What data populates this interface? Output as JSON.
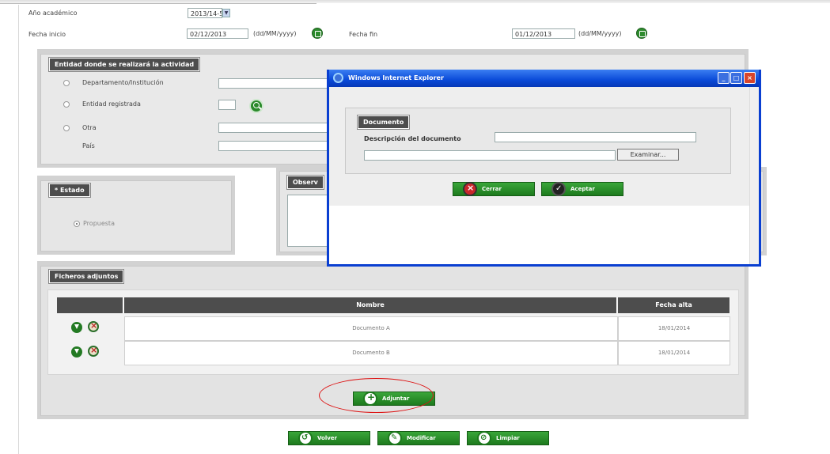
{
  "header": {
    "anio_label": "Año académico",
    "anio_value": "2013/14-5",
    "fecha_inicio_label": "Fecha inicio",
    "fecha_inicio_value": "02/12/2013",
    "fecha_inicio_format": "(dd/MM/yyyy)",
    "fecha_fin_label": "Fecha fin",
    "fecha_fin_value": "01/12/2013",
    "fecha_fin_format": "(dd/MM/yyyy)"
  },
  "entidad": {
    "legend": "Entidad donde se realizará la actividad",
    "opt_departamento": "Departamento/Institución",
    "opt_entidad": "Entidad registrada",
    "opt_otra": "Otra",
    "pais_label": "País"
  },
  "estado": {
    "legend": "* Estado",
    "option": "Propuesta"
  },
  "observaciones": {
    "legend": "Observ"
  },
  "ficheros": {
    "legend": "Ficheros adjuntos",
    "col_nombre": "Nombre",
    "col_fecha": "Fecha alta",
    "rows": [
      {
        "nombre": "Documento A",
        "fecha": "18/01/2014"
      },
      {
        "nombre": "Documento B",
        "fecha": "18/01/2014"
      }
    ],
    "adjuntar": "Adjuntar"
  },
  "actions": {
    "volver": "Volver",
    "modificar": "Modificar",
    "limpiar": "Limpiar"
  },
  "dialog": {
    "title": "Windows Internet Explorer",
    "legend": "Documento",
    "descripcion_label": "Descripción del documento",
    "examinar": "Examinar...",
    "cerrar": "Cerrar",
    "aceptar": "Aceptar"
  },
  "colors": {
    "green": "#1d7a1d",
    "dark_legend": "#4d4d4d",
    "xp_blue": "#0a4ad8",
    "annotation_red": "#d11111"
  }
}
